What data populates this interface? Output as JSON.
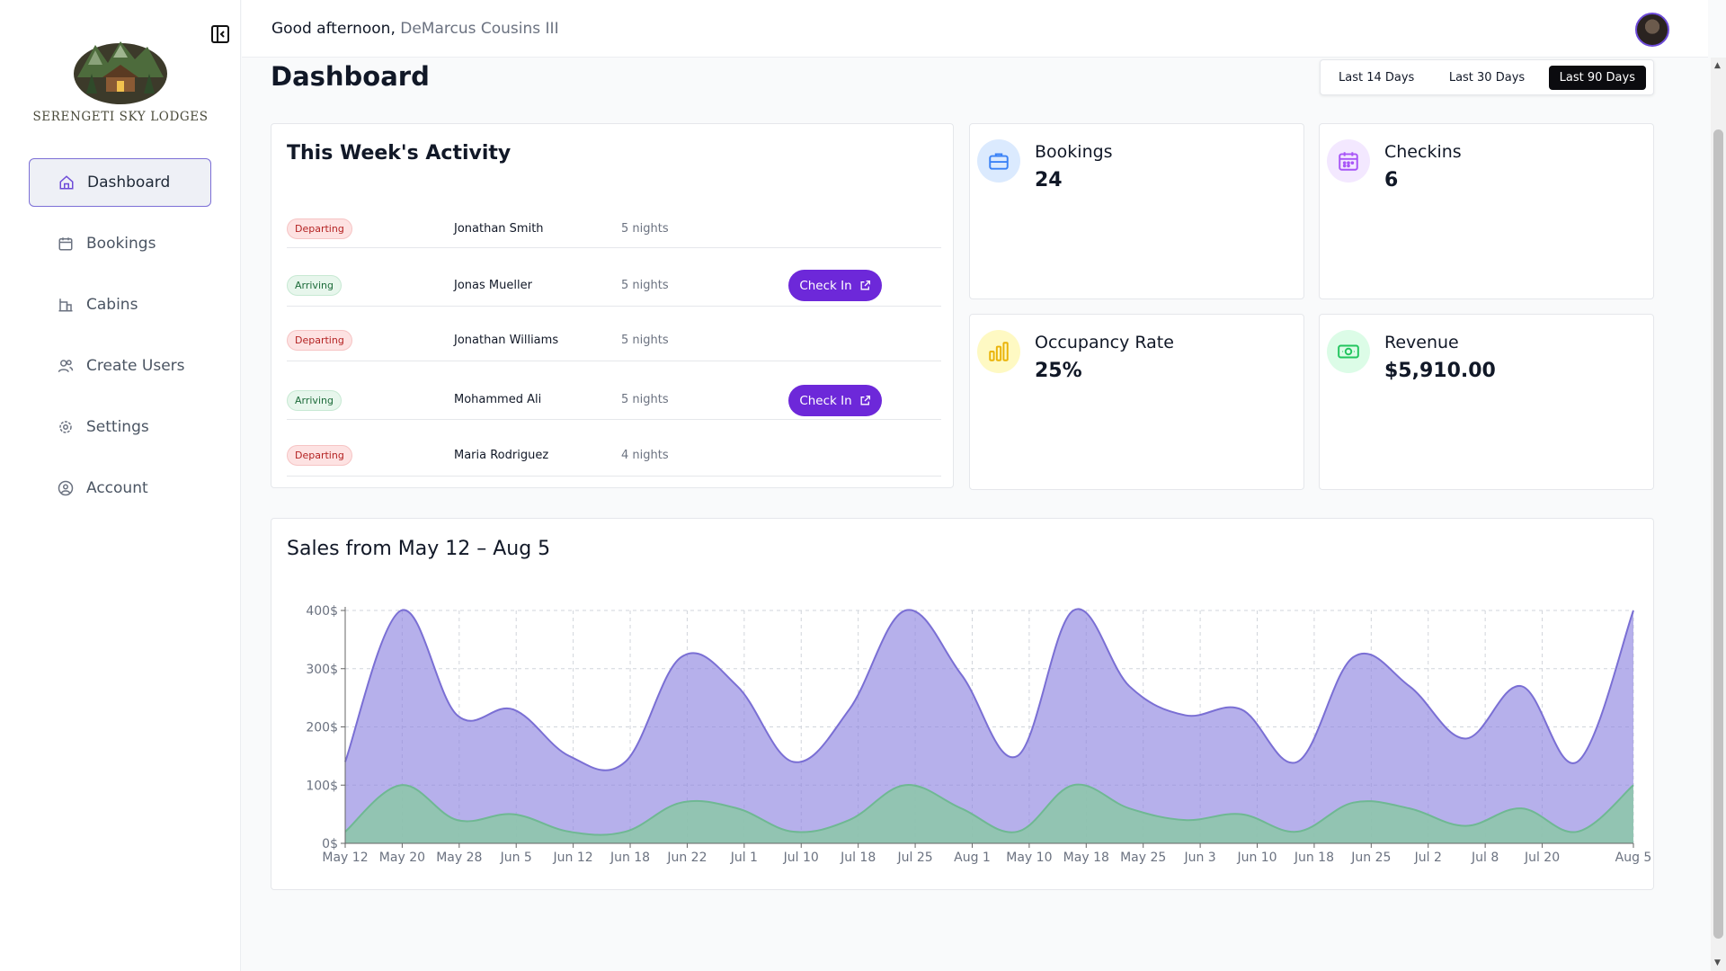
{
  "header": {
    "greeting": "Good afternoon,",
    "user_name": "DeMarcus Cousins III"
  },
  "sidebar": {
    "brand": "SERENGETI SKY LODGES",
    "items": [
      {
        "label": "Dashboard",
        "icon": "home-icon",
        "active": true
      },
      {
        "label": "Bookings",
        "icon": "calendar-icon"
      },
      {
        "label": "Cabins",
        "icon": "building-icon"
      },
      {
        "label": "Create Users",
        "icon": "users-icon"
      },
      {
        "label": "Settings",
        "icon": "gear-icon"
      },
      {
        "label": "Account",
        "icon": "user-circle-icon"
      }
    ]
  },
  "main": {
    "title": "Dashboard",
    "ranges": [
      "Last 14 Days",
      "Last 30 Days",
      "Last 90 Days"
    ],
    "active_range": "Last 90 Days"
  },
  "activity": {
    "title": "This Week's Activity",
    "check_in_label": "Check In",
    "rows": [
      {
        "status": "Departing",
        "guest": "Jonathan Smith",
        "nights": "5 nights"
      },
      {
        "status": "Arriving",
        "guest": "Jonas Mueller",
        "nights": "5 nights"
      },
      {
        "status": "Departing",
        "guest": "Jonathan Williams",
        "nights": "5 nights"
      },
      {
        "status": "Arriving",
        "guest": "Mohammed Ali",
        "nights": "5 nights"
      },
      {
        "status": "Departing",
        "guest": "Maria Rodriguez",
        "nights": "4 nights"
      }
    ]
  },
  "stats": {
    "bookings": {
      "label": "Bookings",
      "value": "24",
      "icon": "briefcase-icon",
      "color": "#3b82f6"
    },
    "checkins": {
      "label": "Checkins",
      "value": "6",
      "icon": "calendar-icon",
      "color": "#a855f7"
    },
    "occupancy": {
      "label": "Occupancy Rate",
      "value": "25%",
      "icon": "bar-chart-icon",
      "color": "#eab308"
    },
    "revenue": {
      "label": "Revenue",
      "value": "$5,910.00",
      "icon": "banknote-icon",
      "color": "#22c55e"
    }
  },
  "sales": {
    "title": "Sales from May 12 – Aug 5"
  },
  "chart_data": {
    "type": "area",
    "categories": [
      "May 12",
      "May 20",
      "May 28",
      "Jun 5",
      "Jun 12",
      "Jun 18",
      "Jun 22",
      "Jul 1",
      "Jul 10",
      "Jul 18",
      "Jul 25",
      "Aug 1",
      "May 10",
      "May 18",
      "May 25",
      "Jun 3",
      "Jun 10",
      "Jun 18",
      "Jun 25",
      "Jul 2",
      "Jul 8",
      "Jul 20",
      "Aug 5"
    ],
    "series": [
      {
        "values": [
          140,
          400,
          220,
          230,
          150,
          140,
          320,
          270,
          140,
          230,
          400,
          290,
          150,
          400,
          270,
          220,
          230,
          140,
          320,
          270,
          180,
          270,
          140,
          400
        ],
        "color": "#8f86e0"
      },
      {
        "values": [
          20,
          100,
          40,
          50,
          20,
          20,
          70,
          60,
          20,
          40,
          100,
          60,
          20,
          100,
          60,
          40,
          50,
          20,
          70,
          60,
          30,
          60,
          20,
          100
        ],
        "color": "#8cc8a8"
      }
    ],
    "y_ticks": [
      "0$",
      "100$",
      "200$",
      "300$",
      "400$"
    ],
    "ylim": [
      0,
      400
    ],
    "grid": true
  }
}
